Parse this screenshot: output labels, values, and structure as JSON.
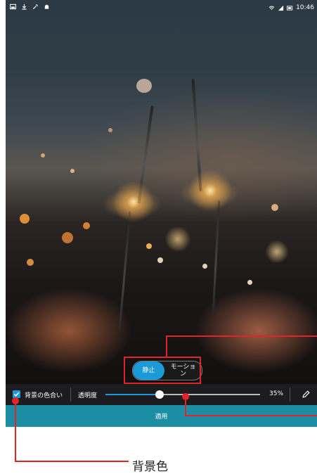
{
  "status_bar": {
    "left_icons": [
      "image-icon",
      "download-icon",
      "tools-icon",
      "android-icon"
    ],
    "time": "10:46"
  },
  "toggle": {
    "still_label": "静止",
    "motion_label": "モーショ ン",
    "selected": "still"
  },
  "toolbar": {
    "bg_tint_label": "背景の色合い",
    "bg_tint_checked": true,
    "transparency_label": "透明度",
    "transparency_value": "35%",
    "slider_fraction": 0.35
  },
  "apply": {
    "label": "適用"
  },
  "callout": {
    "label": "背景色"
  },
  "colors": {
    "accent": "#1a9bd8",
    "apply_bar": "#1b8ea5",
    "annotation": "#e2232a"
  }
}
